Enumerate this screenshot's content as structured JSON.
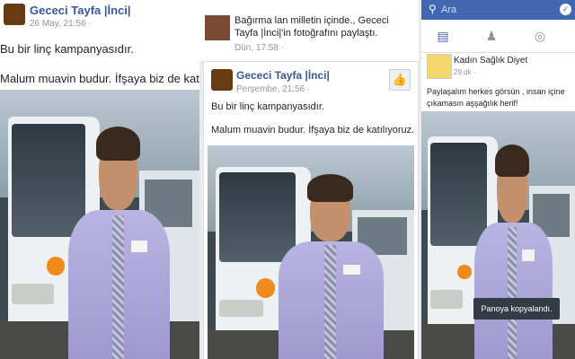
{
  "post_left": {
    "author": "Gececi Tayfa |İnci|",
    "date": "26 May, 21:56 · ",
    "line1": "Bu bir linç kampanyasıdır.",
    "line2": "Malum muavin budur. İfşaya biz de katılıyoruz."
  },
  "post_middle": {
    "share_text": "Bağırma lan milletin içinde., Gececi Tayfa |İnci|'in fotoğrafını paylaştı.",
    "share_date": "Dün, 17:58 · ",
    "author": "Gececi Tayfa |İnci|",
    "date": "Perşembe, 21:56 · ",
    "like_icon": "thumbs-up-icon",
    "line1": "Bu bir linç kampanyasıdır.",
    "line2": "Malum muavin budur. İfşaya biz de katılıyoruz."
  },
  "post_right": {
    "search_placeholder": "Ara",
    "author": "Kadın Sağlık Diyet",
    "date": "29 dk · ",
    "text": "Paylaşalım herkes görsün , insan içine çıkamasın aşşağılık herif!",
    "toast": "Panoya kopyalandı."
  },
  "colors": {
    "facebook_blue": "#4267b2",
    "link_blue": "#365899"
  }
}
